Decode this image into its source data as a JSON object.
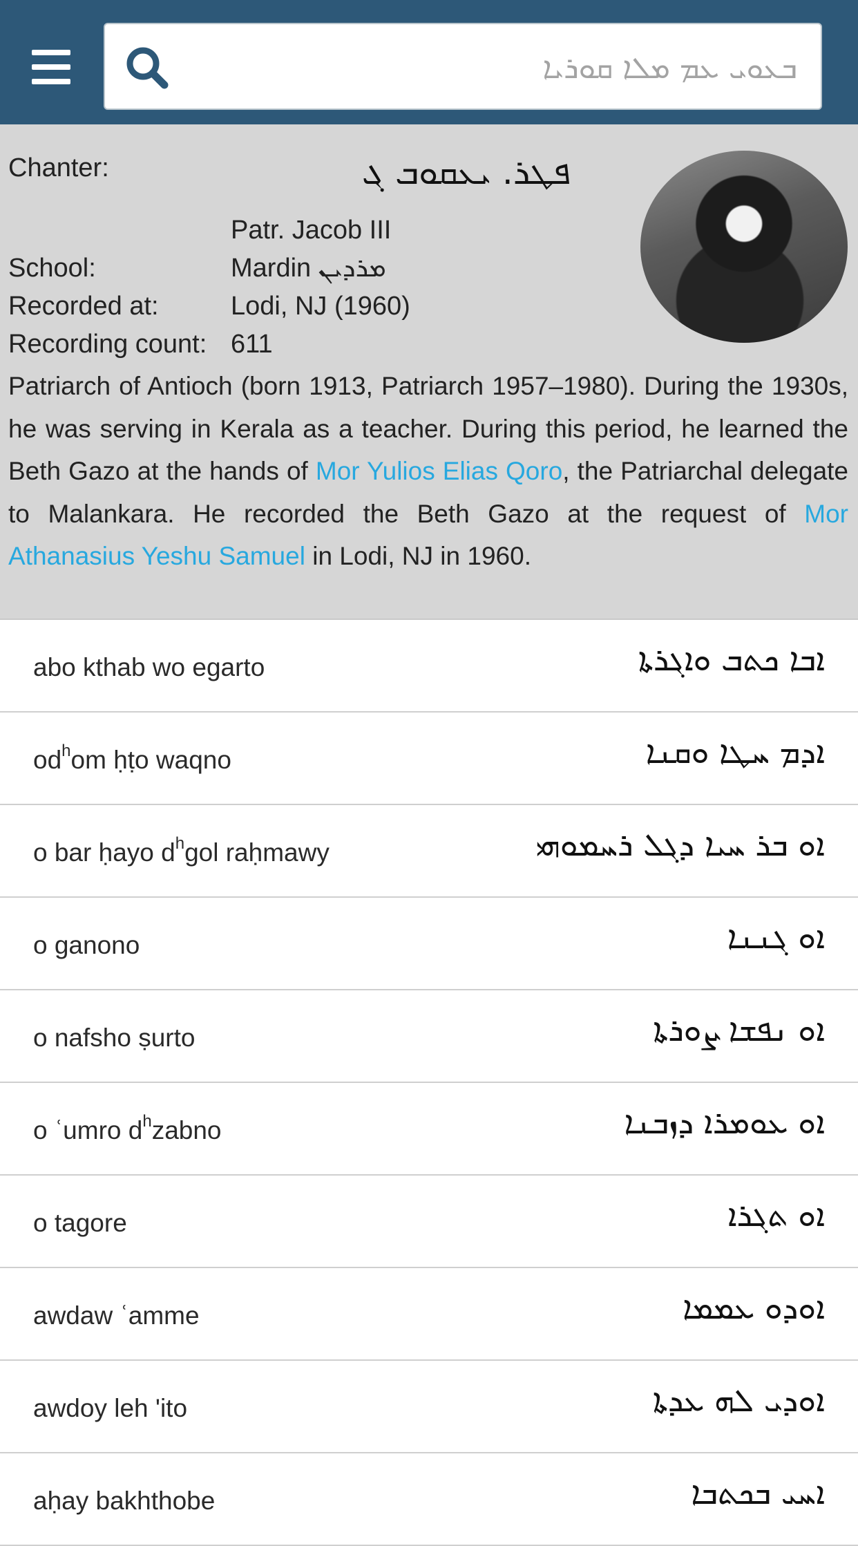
{
  "header": {
    "search_placeholder": "ܒܥܘܝ ܥܡ ܡܠܐ ܩܘܪܝܐ"
  },
  "chanter": {
    "label": "Chanter:",
    "syriac_name": "ܦܛܪ. ܝܥܩܘܒ ܓ",
    "name": "Patr. Jacob III",
    "school_label": "School:",
    "school_value": "Mardin ܡܪܕܝܢ",
    "recorded_label": "Recorded at:",
    "recorded_value": "Lodi, NJ (1960)",
    "count_label": "Recording count:",
    "count_value": "611",
    "bio_part1": "Patriarch of Antioch (born 1913, Patriarch 1957–1980). During the 1930s, he was serving in Kerala as a teacher. During this period, he learned the Beth Gazo at the hands of ",
    "bio_link1": "Mor Yulios Elias Qoro",
    "bio_part2": ", the Patriarchal delegate to Malankara. He recorded the Beth Gazo at the request of ",
    "bio_link2": "Mor Athanasius Yeshu Samuel",
    "bio_part3": " in Lodi, NJ in 1960."
  },
  "tunes": [
    {
      "pre": "abo kthab wo egarto",
      "sup": "",
      "post": "",
      "syriac": "ܐܒܐ ܟܬܒ ܘܐܓܪܬܐ"
    },
    {
      "pre": "od",
      "sup": "h",
      "post": "om ḥṭo waqno",
      "syriac": "ܐܕܡ ܚܛܐ ܘܩܢܐ"
    },
    {
      "pre": "o bar ḥayo d",
      "sup": "h",
      "post": "gol raḥmawy",
      "syriac": "ܐܘ ܒܪ ܚܝܐ ܕܓܠ ܪܚܡܘܗܝ"
    },
    {
      "pre": "o ganono",
      "sup": "",
      "post": "",
      "syriac": "ܐܘ ܓܢܢܐ"
    },
    {
      "pre": "o nafsho ṣurto",
      "sup": "",
      "post": "",
      "syriac": "ܐܘ ܢܦܫܐ ܨܘܪܬܐ"
    },
    {
      "pre": "o ʿumro d",
      "sup": "h",
      "post": "zabno",
      "syriac": "ܐܘ ܥܘܡܪܐ ܕܙܒܢܐ"
    },
    {
      "pre": "o tagore",
      "sup": "",
      "post": "",
      "syriac": "ܐܘ ܬܓܪܐ"
    },
    {
      "pre": "awdaw ʿamme",
      "sup": "",
      "post": "",
      "syriac": "ܐܘܕܘ ܥܡܡܐ"
    },
    {
      "pre": "awdoy leh 'ito",
      "sup": "",
      "post": "",
      "syriac": "ܐܘܕܝ ܠܗ ܥܕܬܐ"
    },
    {
      "pre": "aḥay bakhthobe",
      "sup": "",
      "post": "",
      "syriac": "ܐܚܝ ܒܟܬܒܐ"
    }
  ]
}
